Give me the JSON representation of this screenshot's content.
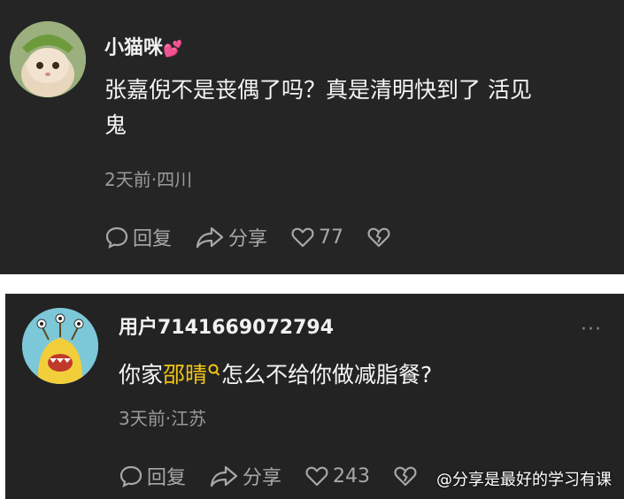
{
  "comments": [
    {
      "username": "小猫咪",
      "username_emoji": "💕",
      "text_line1": "张嘉倪不是丧偶了吗？真是清明快到了 活见",
      "text_line2": "鬼",
      "meta": "2天前·四川",
      "reply_label": "回复",
      "share_label": "分享",
      "like_count": "77"
    },
    {
      "username": "用户7141669072794",
      "text_before": "你家",
      "highlight": "邵晴",
      "text_after": "怎么不给你做减脂餐?",
      "meta": "3天前·江苏",
      "reply_label": "回复",
      "share_label": "分享",
      "like_count": "243",
      "more_label": "···"
    }
  ],
  "watermark": "@分享是最好的学习有课",
  "colors": {
    "card_bg": "#252525",
    "highlight": "#f0c419",
    "meta": "#9a9a9a"
  },
  "icons": [
    "reply-icon",
    "share-icon",
    "heart-icon",
    "broken-heart-icon",
    "search-icon"
  ]
}
